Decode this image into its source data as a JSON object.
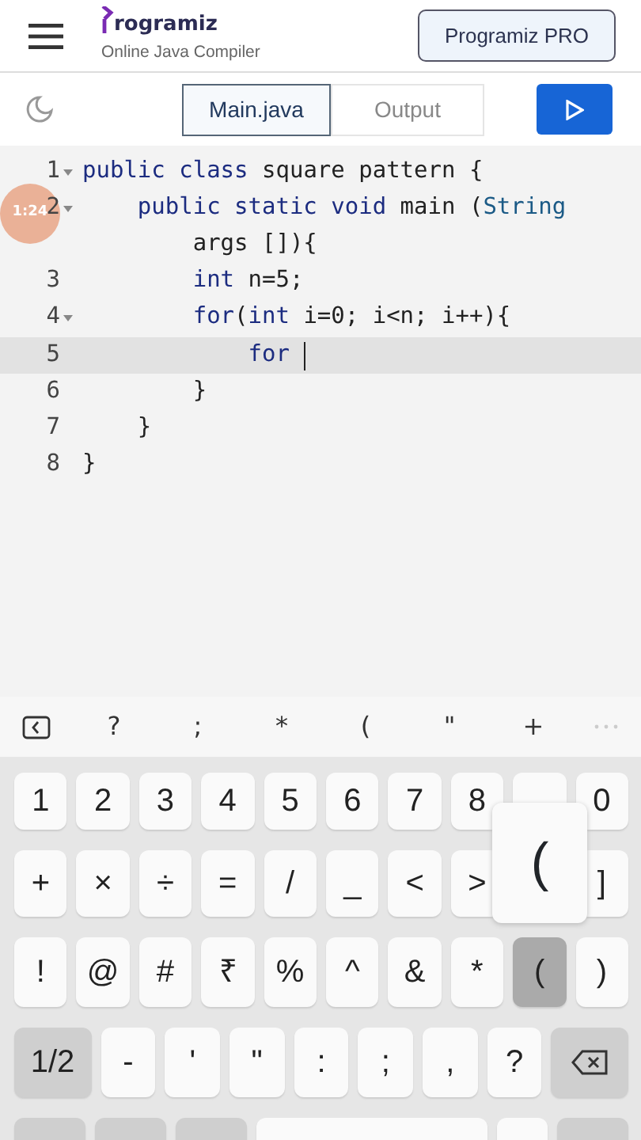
{
  "header": {
    "logo_text": "rogramiz",
    "subtitle": "Online Java Compiler",
    "pro_button": "Programiz PRO"
  },
  "tabs": [
    {
      "label": "Main.java",
      "selected": true
    },
    {
      "label": "Output",
      "selected": false
    }
  ],
  "editor": {
    "lines": [
      {
        "number": "1",
        "fold": true,
        "active": false,
        "tokens": [
          {
            "kind": "keyword",
            "text": "public "
          },
          {
            "kind": "keyword",
            "text": "class "
          },
          {
            "kind": "plain",
            "text": "square pattern {"
          }
        ]
      },
      {
        "number": "2",
        "fold": true,
        "active": false,
        "tokens": [
          {
            "kind": "keyword",
            "text": "    public "
          },
          {
            "kind": "keyword",
            "text": "static "
          },
          {
            "kind": "keyword",
            "text": "void "
          },
          {
            "kind": "plain",
            "text": "main ("
          },
          {
            "kind": "type",
            "text": "String"
          }
        ]
      },
      {
        "fold": false,
        "active": false,
        "tokens": [
          {
            "kind": "plain",
            "text": "        args []){"
          }
        ]
      },
      {
        "number": "3",
        "fold": false,
        "active": false,
        "tokens": [
          {
            "kind": "keyword",
            "text": "        int "
          },
          {
            "kind": "plain",
            "text": "n=5;"
          }
        ]
      },
      {
        "number": "4",
        "fold": true,
        "active": false,
        "tokens": [
          {
            "kind": "keyword",
            "text": "        for"
          },
          {
            "kind": "plain",
            "text": "("
          },
          {
            "kind": "keyword",
            "text": "int "
          },
          {
            "kind": "plain",
            "text": "i=0; i<n; i++){"
          }
        ]
      },
      {
        "number": "5",
        "fold": false,
        "active": true,
        "tokens": [
          {
            "kind": "keyword",
            "text": "            for "
          }
        ]
      },
      {
        "number": "6",
        "fold": false,
        "active": false,
        "tokens": [
          {
            "kind": "plain",
            "text": "        }"
          }
        ]
      },
      {
        "number": "7",
        "fold": false,
        "active": false,
        "tokens": [
          {
            "kind": "plain",
            "text": "    }"
          }
        ]
      },
      {
        "number": "8",
        "fold": false,
        "active": false,
        "tokens": [
          {
            "kind": "plain",
            "text": "}"
          }
        ]
      }
    ],
    "video_timer": "1:24"
  },
  "symbol_bar": [
    {
      "kind": "back"
    },
    {
      "kind": "char",
      "label": "?"
    },
    {
      "kind": "char",
      "label": ";"
    },
    {
      "kind": "char",
      "label": "*"
    },
    {
      "kind": "char",
      "label": "("
    },
    {
      "kind": "char",
      "label": "\""
    },
    {
      "kind": "char",
      "label": "+"
    },
    {
      "kind": "more"
    }
  ],
  "keyboard": {
    "rows": [
      [
        {
          "kind": "char",
          "label": "1"
        },
        {
          "kind": "char",
          "label": "2"
        },
        {
          "kind": "char",
          "label": "3"
        },
        {
          "kind": "char",
          "label": "4"
        },
        {
          "kind": "char",
          "label": "5"
        },
        {
          "kind": "char",
          "label": "6"
        },
        {
          "kind": "char",
          "label": "7"
        },
        {
          "kind": "char",
          "label": "8"
        },
        {
          "kind": "covered"
        },
        {
          "kind": "char",
          "label": "0"
        }
      ],
      [
        {
          "kind": "char",
          "label": "+"
        },
        {
          "kind": "char",
          "label": "×"
        },
        {
          "kind": "char",
          "label": "÷"
        },
        {
          "kind": "char",
          "label": "="
        },
        {
          "kind": "char",
          "label": "/"
        },
        {
          "kind": "char",
          "label": "_"
        },
        {
          "kind": "char",
          "label": "<"
        },
        {
          "kind": "char",
          "label": ">"
        },
        {
          "kind": "hidden"
        },
        {
          "kind": "char",
          "label": "]"
        }
      ],
      [
        {
          "kind": "char",
          "label": "!"
        },
        {
          "kind": "char",
          "label": "@"
        },
        {
          "kind": "char",
          "label": "#"
        },
        {
          "kind": "char",
          "label": "₹"
        },
        {
          "kind": "char",
          "label": "%"
        },
        {
          "kind": "char",
          "label": "^"
        },
        {
          "kind": "char",
          "label": "&"
        },
        {
          "kind": "char",
          "label": "*"
        },
        {
          "kind": "char",
          "label": "(",
          "pressed": true
        },
        {
          "kind": "char",
          "label": ")"
        }
      ],
      [
        {
          "kind": "mod",
          "label": "1/2"
        },
        {
          "kind": "char",
          "label": "-"
        },
        {
          "kind": "char",
          "label": "'"
        },
        {
          "kind": "char",
          "label": "\""
        },
        {
          "kind": "char",
          "label": ":"
        },
        {
          "kind": "char",
          "label": ";"
        },
        {
          "kind": "char",
          "label": ","
        },
        {
          "kind": "char",
          "label": "?"
        },
        {
          "kind": "backspace"
        }
      ],
      [
        {
          "kind": "mod"
        },
        {
          "kind": "mod"
        },
        {
          "kind": "mod"
        },
        {
          "kind": "space"
        },
        {
          "kind": "blank"
        },
        {
          "kind": "mod"
        }
      ]
    ],
    "popup_key": "("
  }
}
